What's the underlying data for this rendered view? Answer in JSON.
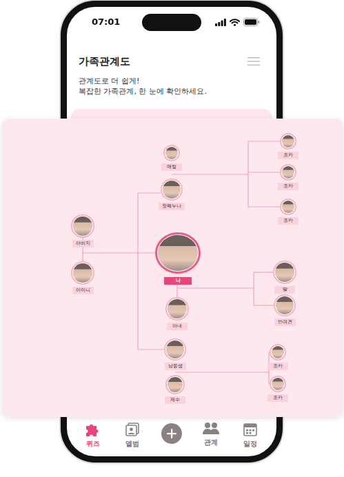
{
  "status_bar": {
    "time": "07:01"
  },
  "header": {
    "title": "가족관계도"
  },
  "intro": [
    "관계도로 더 쉽게!",
    "복잡한 가족관계, 한 눈에 확인하세요."
  ],
  "family_tree": {
    "nodes": [
      {
        "label": "매형",
        "kind": "member"
      },
      {
        "label": "첫째누나",
        "kind": "member"
      },
      {
        "label": "아버지",
        "kind": "member"
      },
      {
        "label": "어머니",
        "kind": "member"
      },
      {
        "label": "나",
        "kind": "self"
      },
      {
        "label": "아내",
        "kind": "member"
      },
      {
        "label": "남동생",
        "kind": "member"
      },
      {
        "label": "제수",
        "kind": "member"
      },
      {
        "label": "조카",
        "kind": "member"
      },
      {
        "label": "조카",
        "kind": "member"
      },
      {
        "label": "조카",
        "kind": "member"
      },
      {
        "label": "딸",
        "kind": "member"
      },
      {
        "label": "반려견",
        "kind": "member"
      },
      {
        "label": "조카",
        "kind": "member"
      },
      {
        "label": "조카",
        "kind": "member"
      }
    ]
  },
  "tabs": [
    {
      "label": "퀴즈",
      "kind": "quiz",
      "selected": true
    },
    {
      "label": "앨범",
      "kind": "album",
      "selected": false
    },
    {
      "kind": "add",
      "selected": false
    },
    {
      "label": "관계",
      "kind": "relation",
      "selected": false
    },
    {
      "label": "일정",
      "kind": "schedule",
      "selected": false
    }
  ]
}
